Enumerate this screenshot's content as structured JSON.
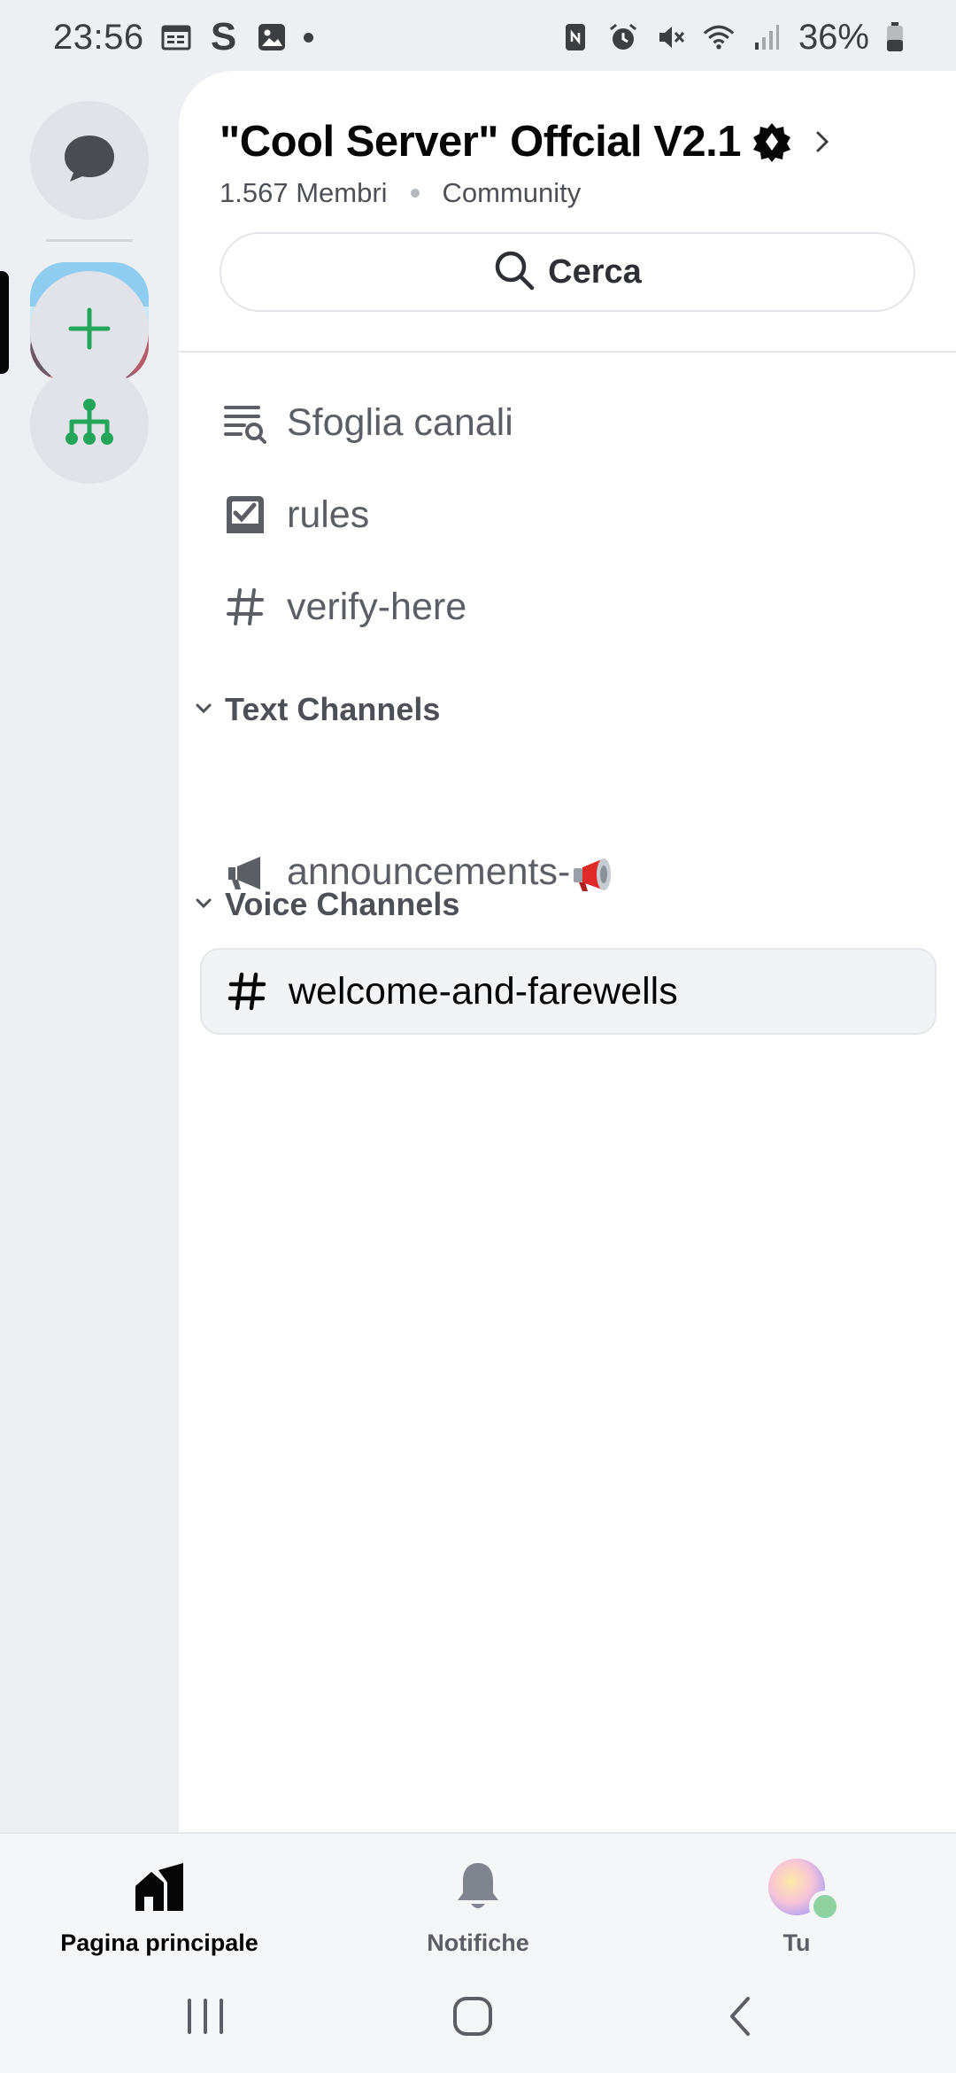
{
  "status_bar": {
    "time": "23:56",
    "battery_percent": "36%",
    "icons_left": [
      "calendar-icon",
      "s-app-icon",
      "gallery-icon",
      "notification-dot"
    ],
    "icons_right": [
      "nfc-icon",
      "alarm-icon",
      "mute-icon",
      "wifi-icon",
      "signal-icon",
      "battery-icon"
    ]
  },
  "rail": {
    "items": [
      "messages-icon",
      "server-avatar",
      "add-server-icon",
      "discover-icon"
    ],
    "accent_color": "#23a55a"
  },
  "server": {
    "name": "\"Cool Server\" Offcial V2.1",
    "members": "1.567 Membri",
    "tag": "Community"
  },
  "search": {
    "label": "Cerca"
  },
  "channels": {
    "top": [
      {
        "label": "Sfoglia canali",
        "icon": "browse-channels-icon"
      },
      {
        "label": "rules",
        "icon": "rules-checkbox-icon"
      },
      {
        "label": "verify-here",
        "icon": "hash-icon"
      }
    ],
    "categories": [
      {
        "label": "Text Channels",
        "channels": [
          {
            "label": "announcements-",
            "icon": "megaphone-icon",
            "emoji": "megaphone-emoji"
          }
        ]
      },
      {
        "label": "Voice Channels",
        "channels": [
          {
            "label": "welcome-and-farewells",
            "icon": "hash-icon",
            "selected": true
          }
        ]
      }
    ]
  },
  "bottom_nav": {
    "items": [
      {
        "label": "Pagina principale",
        "icon": "home-icon",
        "active": true
      },
      {
        "label": "Notifiche",
        "icon": "bell-icon"
      },
      {
        "label": "Tu",
        "icon": "user-avatar",
        "status_color": "#8fd3a3"
      }
    ]
  },
  "system_nav": [
    "recents-icon",
    "home-circle-icon",
    "back-icon"
  ]
}
